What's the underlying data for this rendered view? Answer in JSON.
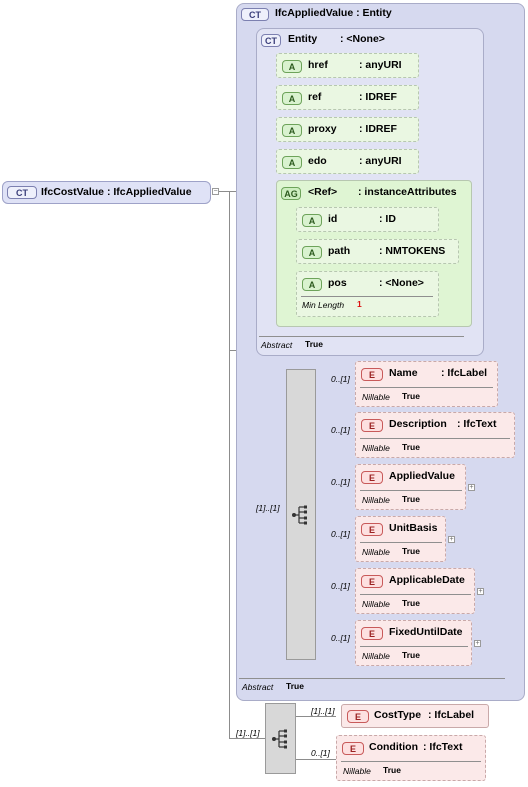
{
  "root": {
    "badge": "CT",
    "label": "IfcCostValue : IfcAppliedValue"
  },
  "applied_value": {
    "badge": "CT",
    "label": "IfcAppliedValue : Entity",
    "abstract_label": "Abstract",
    "abstract_value": "True"
  },
  "entity": {
    "badge": "CT",
    "name": "Entity",
    "type": ": <None>",
    "abstract_label": "Abstract",
    "abstract_value": "True"
  },
  "attributes": [
    {
      "badge": "A",
      "name": "href",
      "type": ": anyURI"
    },
    {
      "badge": "A",
      "name": "ref",
      "type": ": IDREF"
    },
    {
      "badge": "A",
      "name": "proxy",
      "type": ": IDREF"
    },
    {
      "badge": "A",
      "name": "edo",
      "type": ": anyURI"
    }
  ],
  "attribute_group": {
    "badge": "AG",
    "name": "<Ref>",
    "type": ": instanceAttributes",
    "items": [
      {
        "badge": "A",
        "name": "id",
        "type": ": ID"
      },
      {
        "badge": "A",
        "name": "path",
        "type": ": NMTOKENS"
      },
      {
        "badge": "A",
        "name": "pos",
        "type": ": <None>",
        "facet_label": "Min Length",
        "facet_value": "1"
      }
    ]
  },
  "sequence_mult": "[1]..[1]",
  "elements": [
    {
      "badge": "E",
      "name": "Name",
      "type": ": IfcLabel",
      "mult": "0..[1]",
      "nillable_label": "Nillable",
      "nillable_value": "True",
      "expand": ""
    },
    {
      "badge": "E",
      "name": "Description",
      "type": ": IfcText",
      "mult": "0..[1]",
      "nillable_label": "Nillable",
      "nillable_value": "True",
      "expand": ""
    },
    {
      "badge": "E",
      "name": "AppliedValue",
      "type": "",
      "mult": "0..[1]",
      "nillable_label": "Nillable",
      "nillable_value": "True",
      "expand": "+"
    },
    {
      "badge": "E",
      "name": "UnitBasis",
      "type": "",
      "mult": "0..[1]",
      "nillable_label": "Nillable",
      "nillable_value": "True",
      "expand": "+"
    },
    {
      "badge": "E",
      "name": "ApplicableDate",
      "type": "",
      "mult": "0..[1]",
      "nillable_label": "Nillable",
      "nillable_value": "True",
      "expand": "+"
    },
    {
      "badge": "E",
      "name": "FixedUntilDate",
      "type": "",
      "mult": "0..[1]",
      "nillable_label": "Nillable",
      "nillable_value": "True",
      "expand": "+"
    }
  ],
  "bottom_sequence_mult": "[1]..[1]",
  "bottom_elements": [
    {
      "badge": "E",
      "name": "CostType",
      "type": ": IfcLabel",
      "mult": "[1]..[1]"
    },
    {
      "badge": "E",
      "name": "Condition",
      "type": ": IfcText",
      "mult": "0..[1]",
      "nillable_label": "Nillable",
      "nillable_value": "True"
    }
  ]
}
